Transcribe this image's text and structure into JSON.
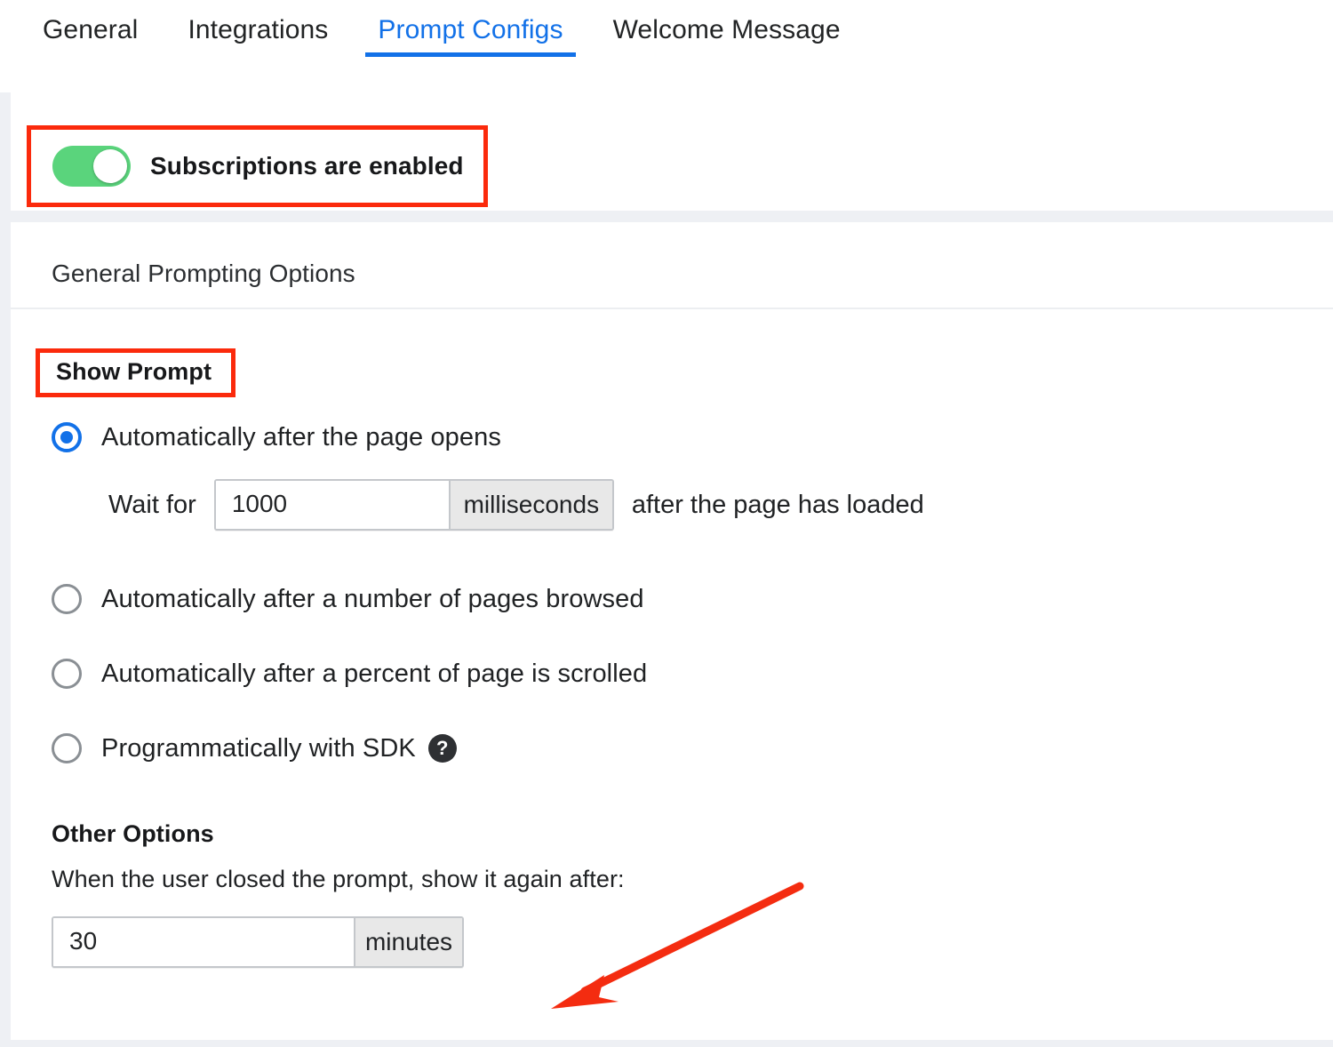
{
  "tabs": [
    {
      "label": "General",
      "active": false
    },
    {
      "label": "Integrations",
      "active": false
    },
    {
      "label": "Prompt Configs",
      "active": true
    },
    {
      "label": "Welcome Message",
      "active": false
    }
  ],
  "subscriptions": {
    "toggle_state": "on",
    "label": "Subscriptions are enabled"
  },
  "general_prompting": {
    "section_title": "General Prompting Options",
    "show_prompt_label": "Show Prompt",
    "options": [
      {
        "label": "Automatically after the page opens",
        "selected": true
      },
      {
        "label": "Automatically after a number of pages browsed",
        "selected": false
      },
      {
        "label": "Automatically after a percent of page is scrolled",
        "selected": false
      },
      {
        "label": "Programmatically with SDK",
        "selected": false,
        "help_icon": "help-question-icon"
      }
    ],
    "wait_row": {
      "prefix": "Wait for",
      "value": "1000",
      "unit": "milliseconds",
      "suffix": "after the page has loaded"
    }
  },
  "other_options": {
    "title": "Other Options",
    "description": "When the user closed the prompt, show it again after:",
    "reshow": {
      "value": "30",
      "unit": "minutes"
    }
  },
  "annotations": {
    "highlight_color": "#fb2a0c",
    "arrow_color": "#f42c10"
  },
  "colors": {
    "accent_blue": "#1271e8",
    "toggle_green": "#5ad47c",
    "page_background": "#eef0f4"
  }
}
